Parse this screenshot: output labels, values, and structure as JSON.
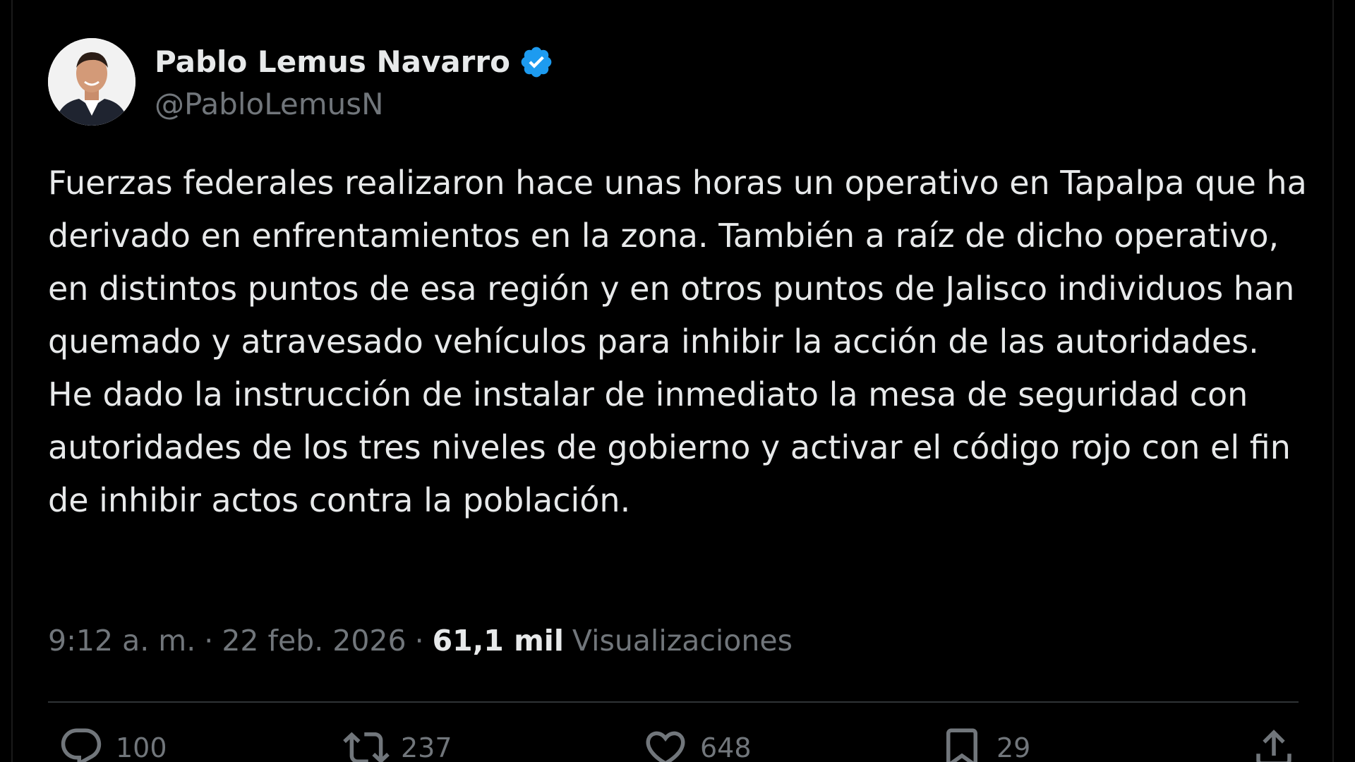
{
  "author": {
    "name": "Pablo Lemus Navarro",
    "handle": "@PabloLemusN",
    "verified": true
  },
  "tweet": {
    "paragraph_1": "Fuerzas federales realizaron hace unas horas un operativo en Tapalpa que ha derivado en enfrentamientos en la zona. También a raíz de dicho operativo, en distintos puntos de esa región y en otros puntos de Jalisco individuos han quemado y atravesado vehículos para inhibir la acción de las autoridades.",
    "paragraph_2": "He dado la instrucción de instalar de inmediato la mesa de seguridad con autoridades de los tres niveles de gobierno y activar el código rojo con el fin de inhibir actos contra la población."
  },
  "meta": {
    "time": "9:12 a. m.",
    "separator": "·",
    "date": "22 feb. 2026",
    "views_count": "61,1 mil",
    "views_label": "Visualizaciones"
  },
  "actions": {
    "replies": "100",
    "reposts": "237",
    "likes": "648",
    "bookmarks": "29"
  },
  "colors": {
    "background": "#000000",
    "text": "#e7e9ea",
    "secondary": "#71767b",
    "verified": "#1d9bf0",
    "divider": "#2f3336"
  },
  "icons": [
    "verified-badge-icon",
    "reply-icon",
    "repost-icon",
    "like-icon",
    "bookmark-icon",
    "share-icon"
  ]
}
